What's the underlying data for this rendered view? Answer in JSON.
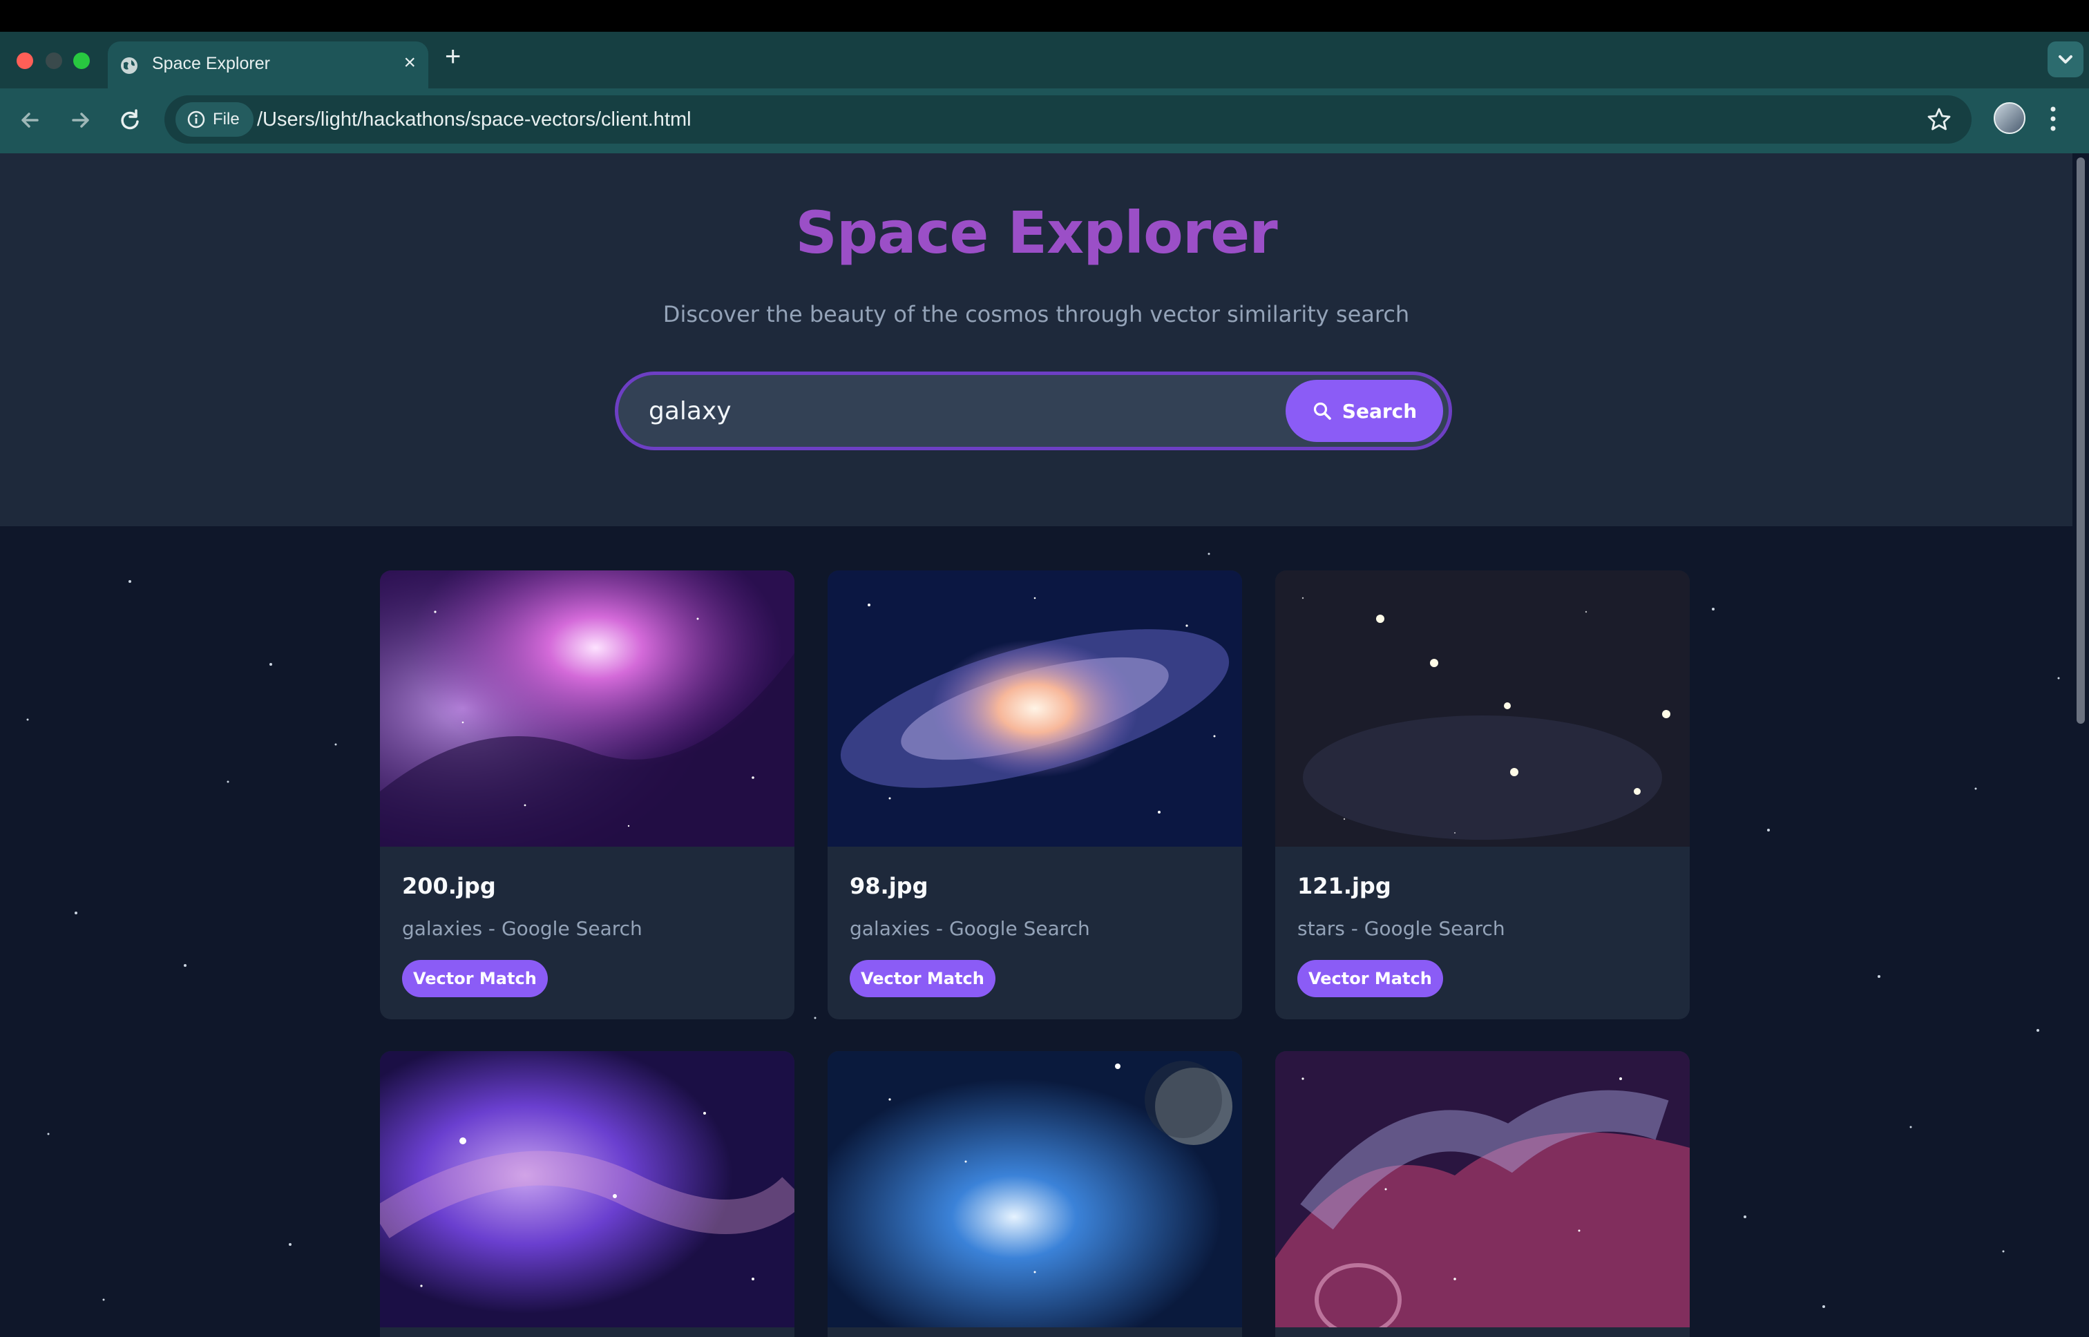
{
  "browser": {
    "tab_title": "Space Explorer",
    "new_tab": "+",
    "close": "×",
    "file_chip": "File",
    "url": "/Users/light/hackathons/space-vectors/client.html"
  },
  "hero": {
    "title": "Space Explorer",
    "subtitle": "Discover the beauty of the cosmos through vector similarity search"
  },
  "search": {
    "value": "galaxy",
    "button_label": "Search"
  },
  "results": [
    {
      "name": "200.jpg",
      "source": "galaxies - Google Search",
      "badge": "Vector Match"
    },
    {
      "name": "98.jpg",
      "source": "galaxies - Google Search",
      "badge": "Vector Match"
    },
    {
      "name": "121.jpg",
      "source": "stars - Google Search",
      "badge": "Vector Match"
    },
    {
      "name": "",
      "source": "",
      "badge": ""
    },
    {
      "name": "",
      "source": "",
      "badge": ""
    },
    {
      "name": "",
      "source": "",
      "badge": ""
    }
  ],
  "colors": {
    "accent": "#8b5cf6",
    "title": "#9b4fc7",
    "hero_bg": "#1e293b",
    "page_bg": "#0f172a",
    "chrome": "#1e5558"
  }
}
